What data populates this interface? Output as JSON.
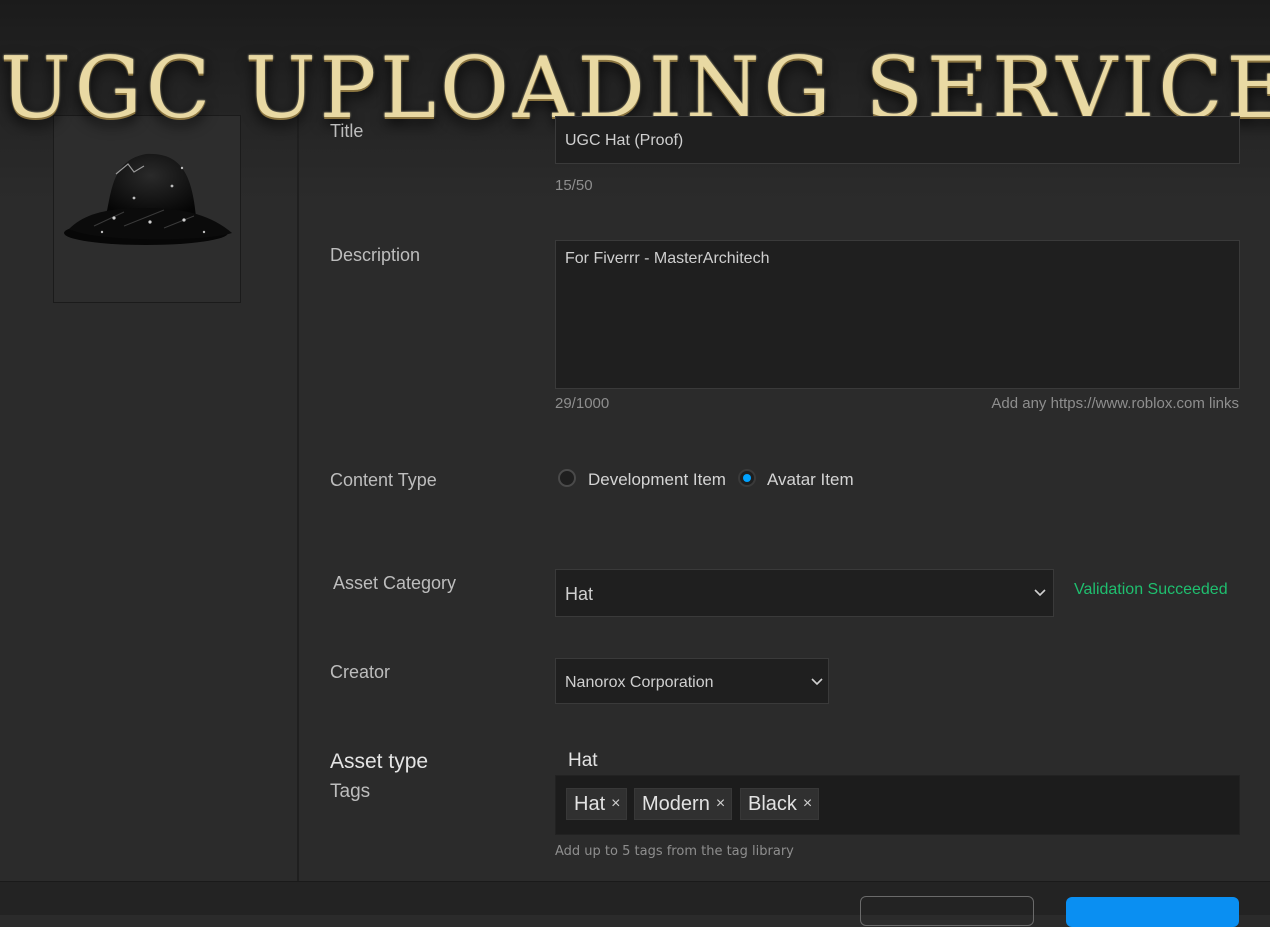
{
  "banner": {
    "title": "UGC UPLOADING SERVICE"
  },
  "form": {
    "title": {
      "label": "Title",
      "value": "UGC Hat (Proof)",
      "counter": "15/50"
    },
    "description": {
      "label": "Description",
      "value": "For Fiverrr - MasterArchitech",
      "counter": "29/1000",
      "hint": "Add any https://www.roblox.com links"
    },
    "content_type": {
      "label": "Content Type",
      "options": [
        {
          "label": "Development Item",
          "selected": false
        },
        {
          "label": "Avatar Item",
          "selected": true
        }
      ]
    },
    "asset_category": {
      "label": "Asset Category",
      "value": "Hat",
      "status": "Validation Succeeded",
      "status_color": "#1fbf6f"
    },
    "creator": {
      "label": "Creator",
      "value": "Nanorox Corporation"
    },
    "asset_type": {
      "label": "Asset type",
      "value": "Hat"
    },
    "tags": {
      "label": "Tags",
      "items": [
        "Hat",
        "Modern",
        "Black"
      ],
      "remove_glyph": "×",
      "hint": "Add up to 5 tags from the tag library"
    }
  },
  "colors": {
    "accent": "#00a2ff",
    "primary_button": "#0a8ff2",
    "banner_gold": "#e9d9a3"
  }
}
